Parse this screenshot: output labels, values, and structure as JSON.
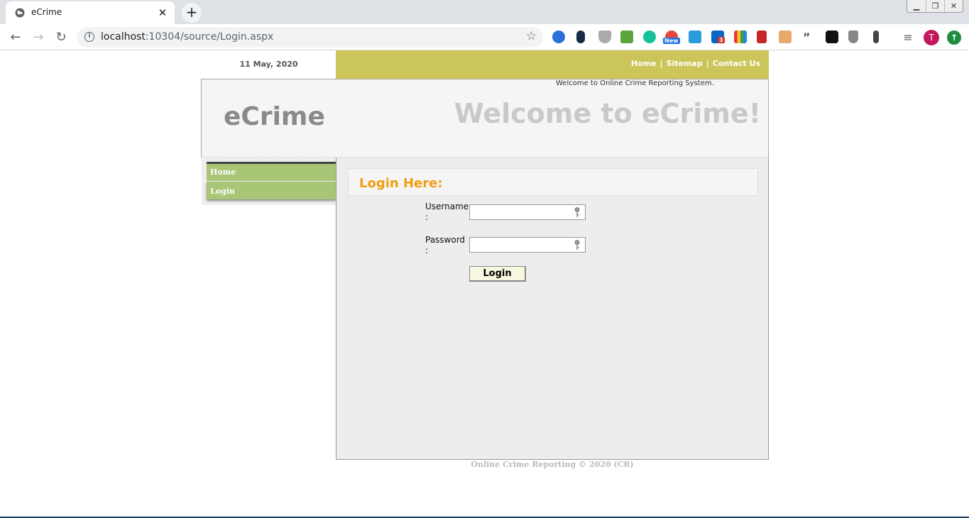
{
  "browser": {
    "tab_title": "eCrime",
    "tab_close": "✕",
    "new_tab": "+",
    "url_host": "localhost",
    "url_path": ":10304/source/Login.aspx",
    "ext_new_badge": "New",
    "ext_linkedin_count": "3",
    "avatar_letter": "T"
  },
  "page": {
    "date": "11 May, 2020",
    "topnav": {
      "home": "Home",
      "sitemap": "Sitemap",
      "contact": "Contact Us"
    },
    "welcome_small": "Welcome to Online Crime Reporting System.",
    "logo": "eCrime",
    "welcome_big": "Welcome to eCrime!",
    "sidebar": {
      "items": [
        {
          "label": "Home"
        },
        {
          "label": "Login"
        }
      ]
    },
    "login": {
      "title": "Login Here:",
      "username_label": "Username :",
      "username_value": "",
      "password_label": "Password :",
      "password_value": "",
      "button": "Login"
    },
    "footer": "Online Crime Reporting © 2020 (CR)"
  },
  "colors": {
    "topnav_bg": "#cbc55a",
    "menu_bg": "#a9c576",
    "login_title": "#f39c12",
    "content_bg": "#ededed"
  }
}
